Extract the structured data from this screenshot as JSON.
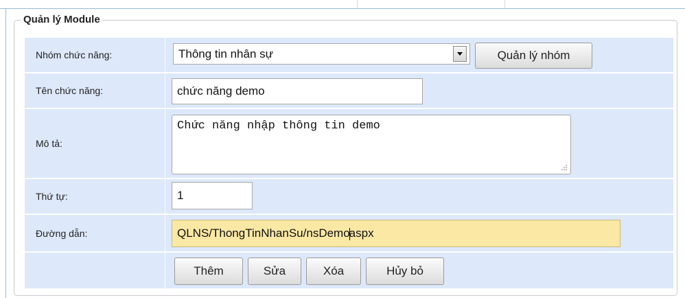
{
  "form": {
    "legend": "Quản lý Module",
    "group_label": "Nhóm chức năng:",
    "group_selected": "Thông tin nhân sự",
    "manage_group_button": "Quản lý nhóm",
    "name_label": "Tên chức năng:",
    "name_value": "chức năng demo",
    "description_label": "Mô tả:",
    "description_value": "Chức năng nhập thông tin demo",
    "order_label": "Thứ tự:",
    "order_value": "1",
    "path_label": "Đường dẫn:",
    "path_value_before": "QLNS/ThongTinNhanSu/nsDemo",
    "path_value_after": "aspx"
  },
  "actions": {
    "add": "Thêm",
    "edit": "Sửa",
    "delete": "Xóa",
    "cancel": "Hủy bỏ"
  }
}
